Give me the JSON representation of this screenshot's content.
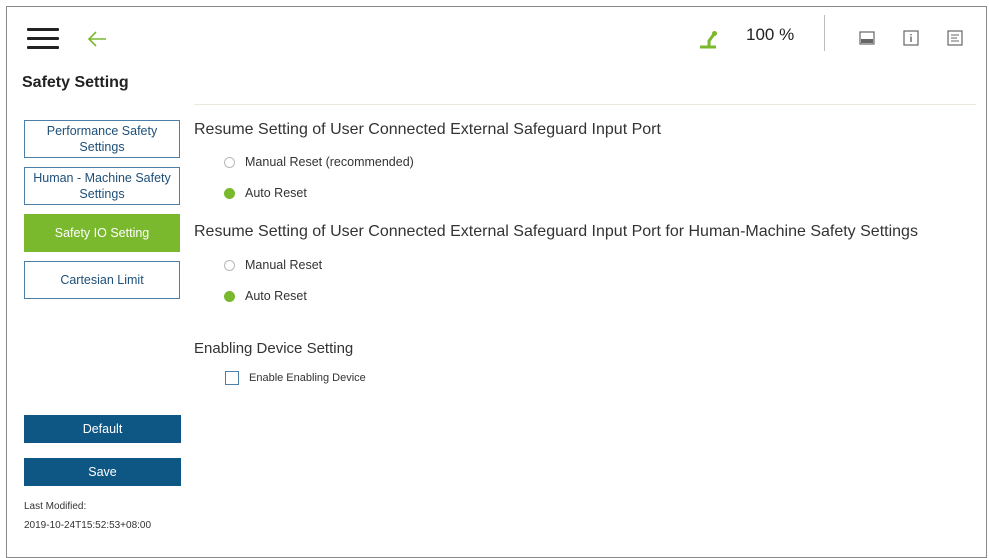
{
  "header": {
    "speed": "100 %",
    "colors": {
      "accent": "#7ab82e",
      "back_arrow": "#7ab82e",
      "primary": "#0e5684"
    }
  },
  "page": {
    "title": "Safety Setting"
  },
  "sidebar": {
    "items": [
      {
        "label": "Performance Safety\nSettings",
        "active": false
      },
      {
        "label": "Human - Machine Safety\nSettings",
        "active": false
      },
      {
        "label": "Safety IO Setting",
        "active": true
      },
      {
        "label": "Cartesian Limit",
        "active": false
      }
    ],
    "default_label": "Default",
    "save_label": "Save",
    "last_modified_label": "Last Modified:",
    "last_modified_value": "2019-10-24T15:52:53+08:00"
  },
  "content": {
    "section1": {
      "title": "Resume Setting of User Connected External Safeguard Input Port",
      "options": [
        {
          "label": "Manual Reset (recommended)",
          "selected": false
        },
        {
          "label": "Auto Reset",
          "selected": true
        }
      ]
    },
    "section2": {
      "title": "Resume Setting of User Connected External Safeguard Input Port for Human-Machine Safety Settings",
      "options": [
        {
          "label": "Manual Reset",
          "selected": false
        },
        {
          "label": "Auto Reset",
          "selected": true
        }
      ]
    },
    "section3": {
      "title": "Enabling Device Setting",
      "checkbox_label": "Enable Enabling Device",
      "checked": false
    }
  },
  "icons": [
    "menu-icon",
    "back-arrow-icon",
    "robot-status-icon",
    "display-icon",
    "info-icon",
    "log-icon"
  ]
}
